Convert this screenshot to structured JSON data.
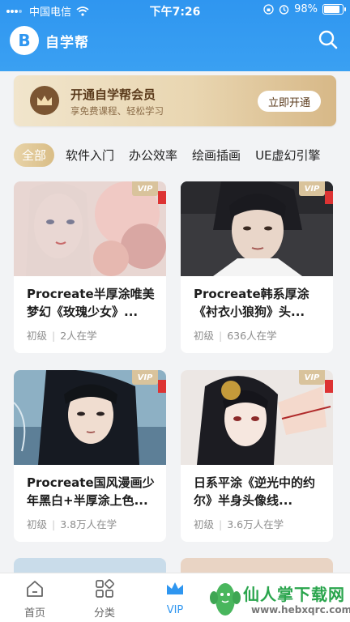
{
  "status": {
    "carrier": "中国电信",
    "time": "下午7:26",
    "battery": "98%"
  },
  "header": {
    "logo_letter": "B",
    "title": "自学帮"
  },
  "vip_banner": {
    "title": "开通自学帮会员",
    "subtitle": "享免费课程、轻松学习",
    "button": "立即开通"
  },
  "categories": [
    "全部",
    "软件入门",
    "办公效率",
    "绘画插画",
    "UE虚幻引擎"
  ],
  "active_category": "全部",
  "courses": [
    {
      "title": "Procreate半厚涂唯美梦幻《玫瑰少女》...",
      "level": "初级",
      "learners": "2人在学",
      "vip": "VIP"
    },
    {
      "title": "Procreate韩系厚涂《衬衣小狼狗》头...",
      "level": "初级",
      "learners": "636人在学",
      "vip": "VIP"
    },
    {
      "title": "Procreate国风漫画少年黑白+半厚涂上色...",
      "level": "初级",
      "learners": "3.8万人在学",
      "vip": "VIP"
    },
    {
      "title": "日系平涂《逆光中的约尔》半身头像线...",
      "level": "初级",
      "learners": "3.6万人在学",
      "vip": "VIP"
    }
  ],
  "tabs": [
    {
      "label": "首页",
      "icon": "home-icon"
    },
    {
      "label": "分类",
      "icon": "grid-icon"
    },
    {
      "label": "VIP",
      "icon": "crown-icon"
    }
  ],
  "watermark": {
    "text": "仙人掌下载网",
    "url": "www.hebxqrc.com"
  },
  "colors": {
    "primary": "#2f96f0",
    "gold": "#d9bd86",
    "vip_dark": "#5a3a1b"
  }
}
